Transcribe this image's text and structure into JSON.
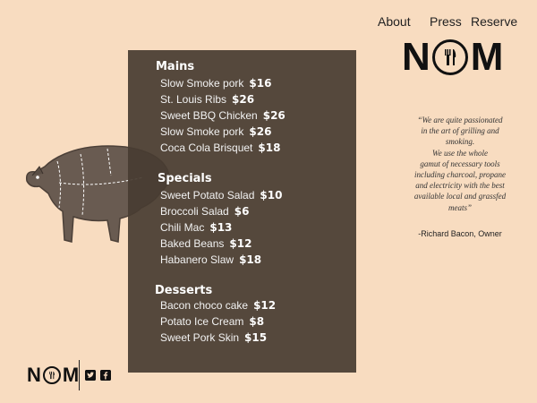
{
  "nav": {
    "about": "About",
    "press": "Press",
    "reserve": "Reserve"
  },
  "brand": {
    "left": "N",
    "right": "M"
  },
  "menu": {
    "mains_title": "Mains",
    "mains": [
      {
        "name": "Slow Smoke pork",
        "price": "$16"
      },
      {
        "name": "St. Louis Ribs",
        "price": "$26"
      },
      {
        "name": "Sweet BBQ Chicken",
        "price": "$26"
      },
      {
        "name": "Slow Smoke pork",
        "price": "$26"
      },
      {
        "name": "Coca Cola Brisquet",
        "price": "$18"
      }
    ],
    "specials_title": "Specials",
    "specials": [
      {
        "name": "Sweet Potato Salad",
        "price": "$10"
      },
      {
        "name": "Broccoli Salad",
        "price": "$6"
      },
      {
        "name": "Chili Mac",
        "price": "$13"
      },
      {
        "name": "Baked Beans",
        "price": "$12"
      },
      {
        "name": "Habanero Slaw",
        "price": "$18"
      }
    ],
    "desserts_title": "Desserts",
    "desserts": [
      {
        "name": "Bacon choco cake",
        "price": "$12"
      },
      {
        "name": "Potato Ice Cream",
        "price": "$8"
      },
      {
        "name": "Sweet Pork Skin",
        "price": "$15"
      }
    ]
  },
  "quote": {
    "lines": [
      "“We are quite passionated",
      "in the art of grilling and",
      "smoking.",
      "We use the whole",
      "gamut of necessary tools",
      "including charcoal, propane",
      "and electricity with  the best",
      "available  local and grassfed",
      "meats”"
    ],
    "attribution": "-Richard Bacon, Owner"
  },
  "social": {
    "twitter_icon": "twitter-icon",
    "facebook_icon": "facebook-icon"
  },
  "colors": {
    "background": "#f8dcc0",
    "panel": "#483c32",
    "text_dark": "#222222"
  }
}
